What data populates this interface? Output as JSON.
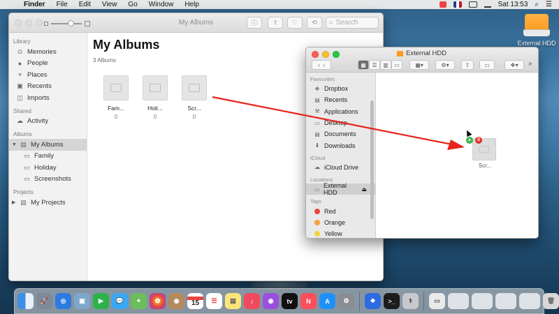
{
  "menubar": {
    "apple": "",
    "items": [
      "Finder",
      "File",
      "Edit",
      "View",
      "Go",
      "Window",
      "Help"
    ],
    "clock": "Sat 13:53"
  },
  "desktop": {
    "drive_label": "External HDD"
  },
  "photos": {
    "title": "My Albums",
    "search_placeholder": "Search",
    "sidebar": {
      "library_header": "Library",
      "library": [
        "Memories",
        "People",
        "Places",
        "Recents",
        "Imports"
      ],
      "shared_header": "Shared",
      "shared": [
        "Activity"
      ],
      "albums_header": "Albums",
      "my_albums": "My Albums",
      "album_items": [
        "Family",
        "Holiday",
        "Screenshots"
      ],
      "projects_header": "Projects",
      "my_projects": "My Projects"
    },
    "main": {
      "heading": "My Albums",
      "count": "3 Albums",
      "albums": [
        {
          "name": "Fam...",
          "count": "0"
        },
        {
          "name": "Holi...",
          "count": "0"
        },
        {
          "name": "Scr...",
          "count": "0"
        }
      ]
    }
  },
  "finder": {
    "title": "External HDD",
    "favourites_header": "Favourites",
    "favourites": [
      "Dropbox",
      "Recents",
      "Applications",
      "Desktop",
      "Documents",
      "Downloads"
    ],
    "icloud_header": "iCloud",
    "icloud": [
      "iCloud Drive"
    ],
    "locations_header": "Locations",
    "location": "External HDD",
    "tags_header": "Tags",
    "tags": [
      {
        "name": "Red",
        "color": "#e9453d"
      },
      {
        "name": "Orange",
        "color": "#f5a23a"
      },
      {
        "name": "Yellow",
        "color": "#f2d33b"
      }
    ]
  },
  "drag": {
    "label": "Scr...",
    "count_badge": "3",
    "arrow_color": "#e8231c"
  },
  "dock": {
    "apps": [
      "finder",
      "launchpad",
      "safari",
      "preview",
      "facetime",
      "messages",
      "maps",
      "photos",
      "contacts",
      "calendar",
      "reminders",
      "notes",
      "music",
      "podcasts",
      "tv",
      "news",
      "app-store",
      "system-preferences",
      "dropbox",
      "terminal",
      "disk-utility"
    ],
    "calendar_day": "15"
  }
}
